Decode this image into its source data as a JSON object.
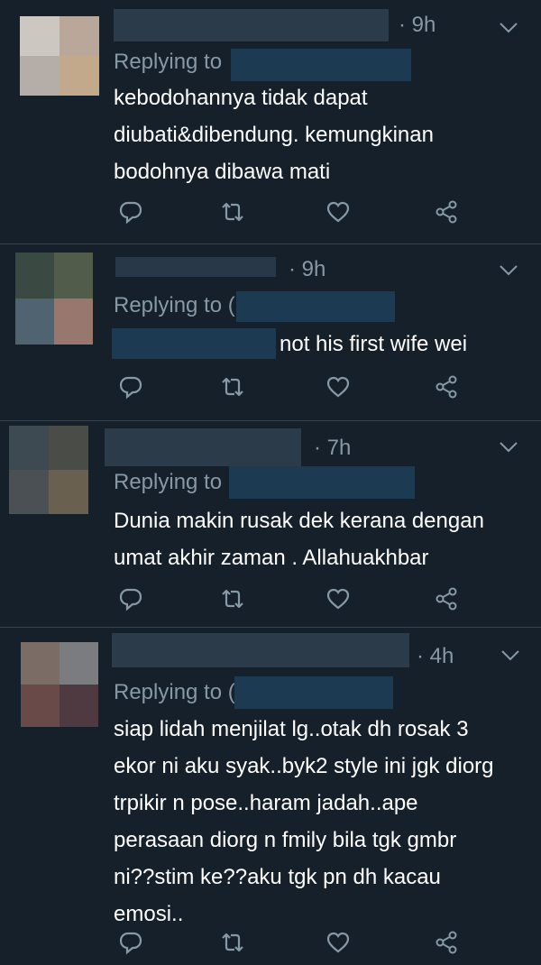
{
  "tweets": [
    {
      "time": "· 9h",
      "replying_label": "Replying to",
      "text_lines": [
        "kebodohannya tidak dapat",
        "diubati&dibendung. kemungkinan",
        "bodohnya dibawa mati"
      ]
    },
    {
      "time": "· 9h",
      "replying_label": "Replying to (",
      "text": "not his first wife wei"
    },
    {
      "time": "· 7h",
      "replying_label": "Replying to",
      "text_lines": [
        "Dunia makin rusak dek kerana dengan",
        "umat akhir zaman . Allahuakhbar"
      ]
    },
    {
      "time": "· 4h",
      "replying_label": "Replying to (",
      "text_lines": [
        "siap lidah menjilat lg..otak dh rosak 3",
        "ekor ni aku syak..byk2 style ini jgk diorg",
        "trpikir n pose..haram jadah..ape",
        "perasaan diorg n fmily bila tgk gmbr",
        "ni??stim ke??aku tgk pn dh kacau",
        "emosi.."
      ]
    }
  ],
  "icons": {
    "reply": "reply-icon",
    "retweet": "retweet-icon",
    "like": "heart-icon",
    "share": "share-icon",
    "more": "chevron-down-icon"
  },
  "colors": {
    "background": "#15202b",
    "secondary_text": "#8899a6",
    "divider": "#38444d",
    "redaction": "#1c3a52"
  }
}
